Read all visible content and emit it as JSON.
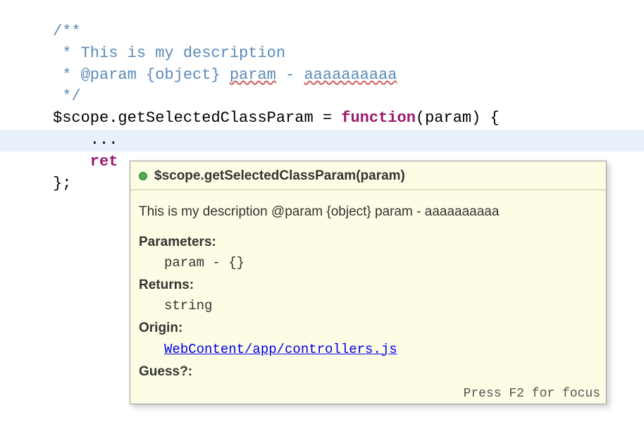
{
  "code": {
    "line1": "/**",
    "line2": " * This is my description",
    "line3_prefix": " * @param {object} ",
    "line3_typo1": "param",
    "line3_mid": " - ",
    "line3_typo2": "aaaaaaaaaa",
    "line4": " */",
    "line5_scope": "$scope",
    "line5_dot": ".",
    "line5_method": "getSelectedClassParam = ",
    "line5_function": "function",
    "line5_rest": "(param) {",
    "line6": "    ...",
    "line7_ret": "    ret",
    "line8": "};"
  },
  "tooltip": {
    "header": "$scope.getSelectedClassParam(param)",
    "description": "This is my description @param {object} param - aaaaaaaaaa",
    "parameters_label": "Parameters:",
    "parameters_value": "param - {}",
    "returns_label": "Returns:",
    "returns_value": "string",
    "origin_label": "Origin:",
    "origin_value": "WebContent/app/controllers.js",
    "guess_label": "Guess?:",
    "footer": "Press F2 for focus"
  }
}
